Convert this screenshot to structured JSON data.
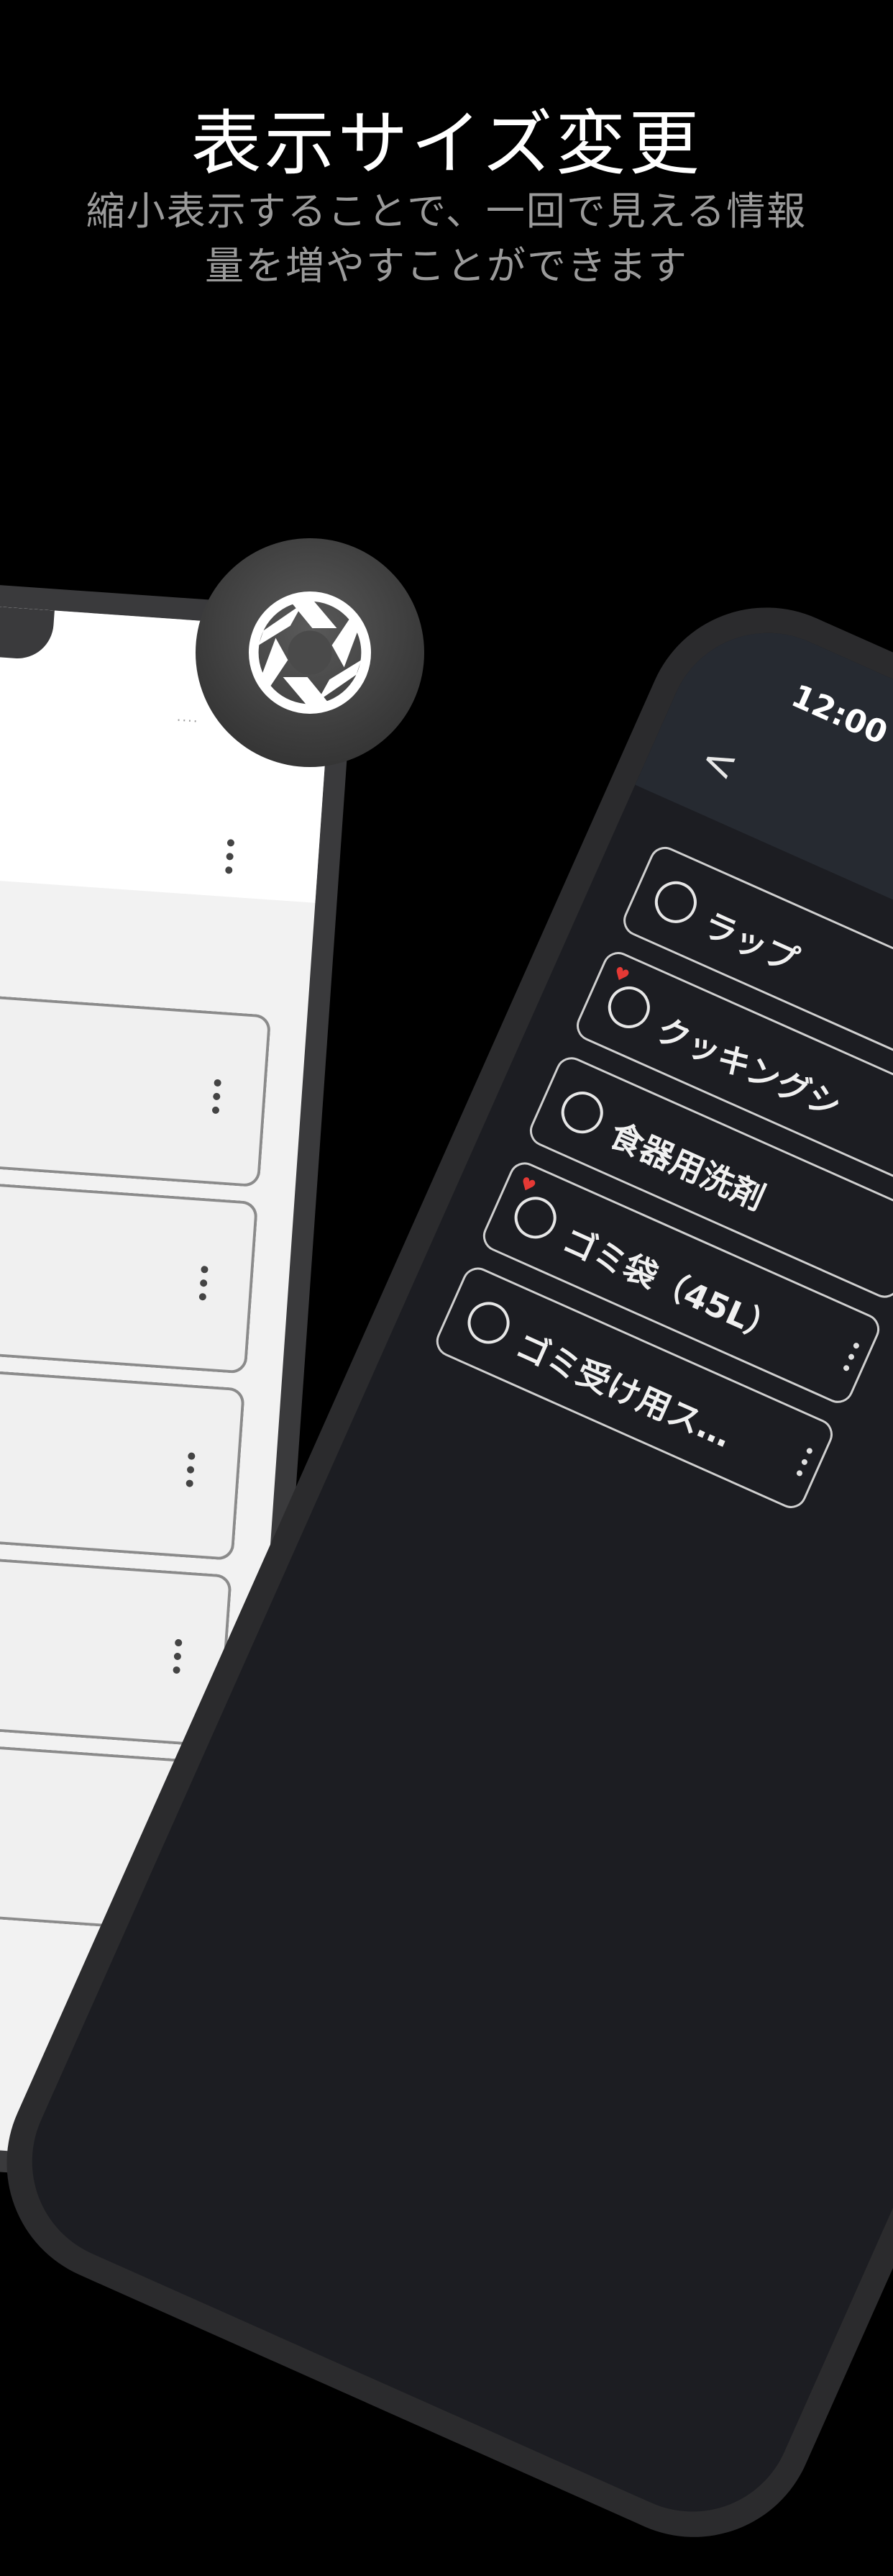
{
  "hero": {
    "title": "表示サイズ変更",
    "subtitle_line1": "縮小表示することで、一回で見える情報",
    "subtitle_line2": "量を増やすことができます"
  },
  "icons": {
    "badge": "aperture-icon",
    "wifi": "wifi-icon",
    "menu": "more-vert-icon",
    "back": "chevron-left-icon",
    "favorite": "heart-icon"
  },
  "colors": {
    "background": "#000000",
    "dark_screen": "#1c1d22",
    "dark_appbar": "#262a31",
    "light_screen": "#f2f2f2",
    "favorite": "#e53935"
  },
  "dark_phone": {
    "time": "12:00",
    "back_label": "<",
    "items": [
      {
        "label": "ラップ",
        "favorite": false
      },
      {
        "label": "クッキングシ",
        "favorite": true
      },
      {
        "label": "食器用洗剤",
        "favorite": false
      },
      {
        "label": "ゴミ袋（45L）",
        "favorite": true
      },
      {
        "label": "ゴミ受け用ス…",
        "favorite": false
      }
    ]
  },
  "light_phone": {
    "signal": "····"
  }
}
